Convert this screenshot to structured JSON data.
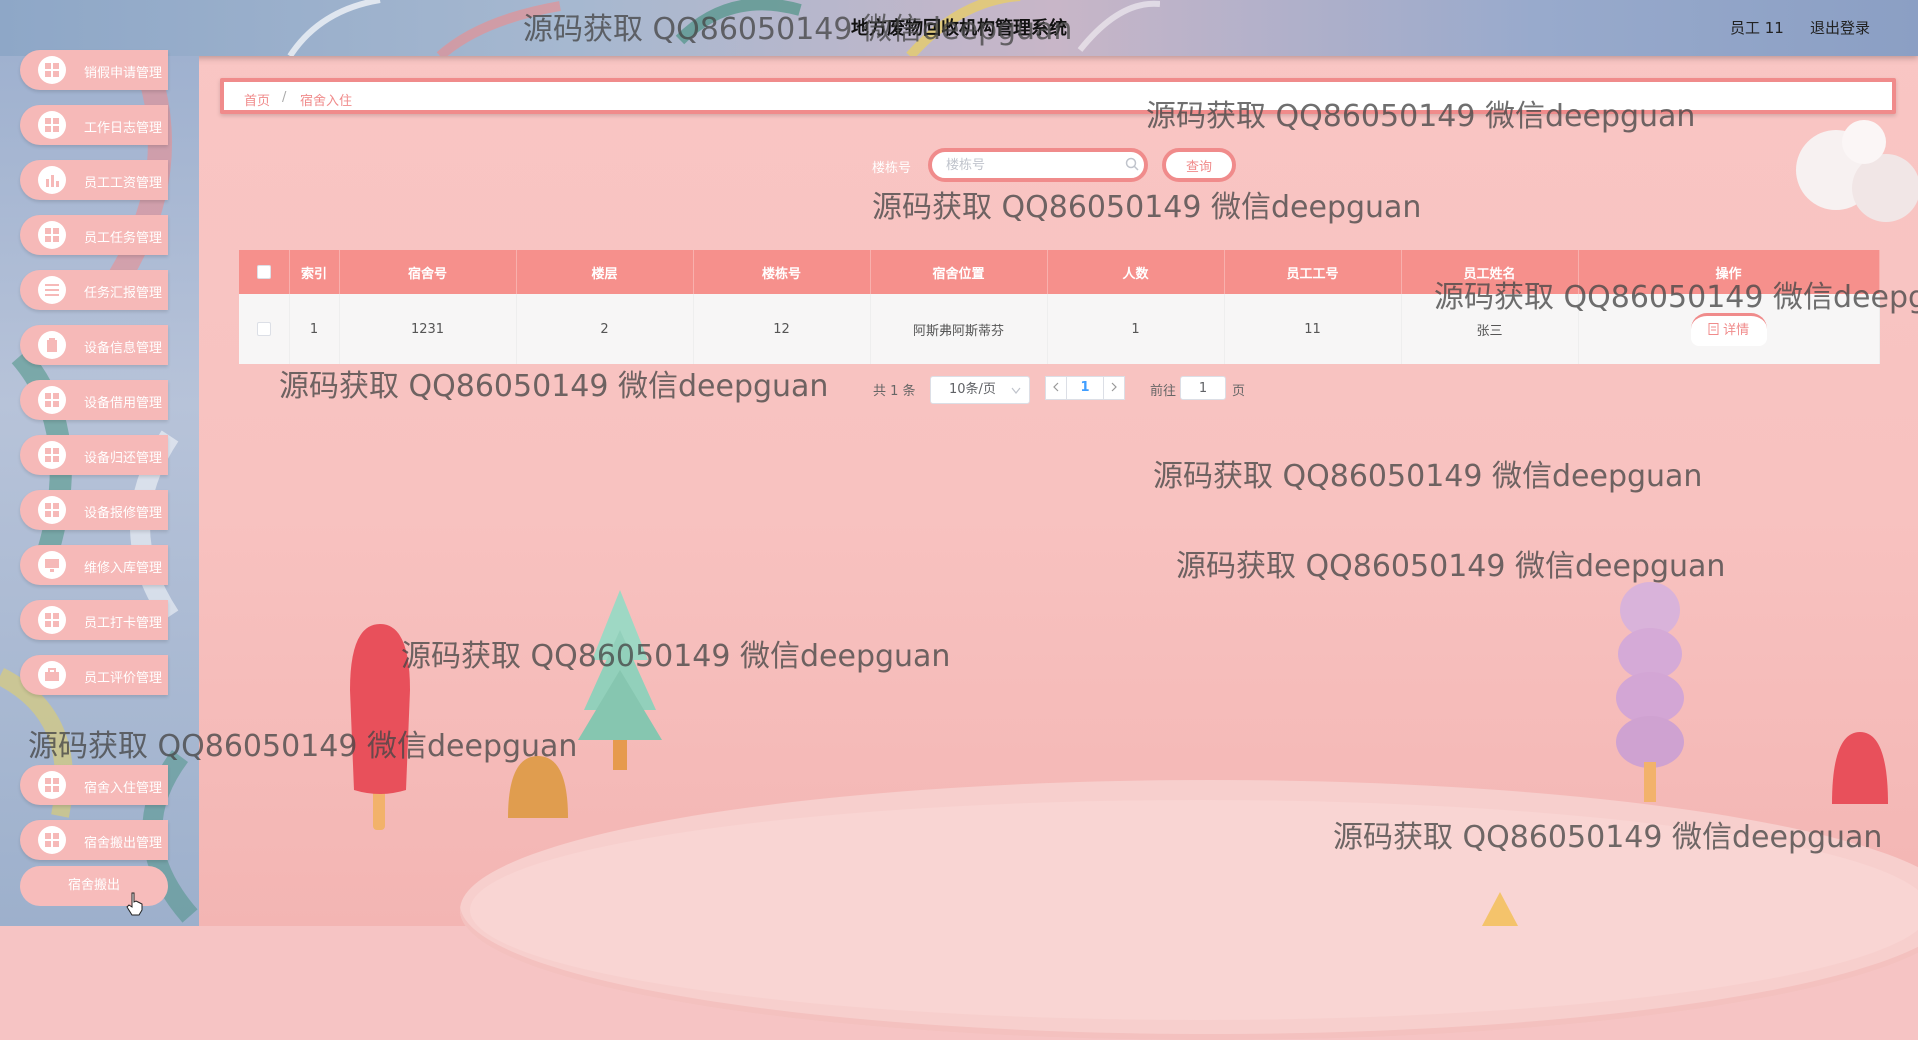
{
  "header": {
    "title": "地方废物回收机构管理系统",
    "user_label": "员工 11",
    "logout_label": "退出登录"
  },
  "sidebar": {
    "items": [
      {
        "label": "销假申请管理",
        "icon": "grid-icon"
      },
      {
        "label": "工作日志管理",
        "icon": "grid-icon"
      },
      {
        "label": "员工工资管理",
        "icon": "bar-chart-icon"
      },
      {
        "label": "员工任务管理",
        "icon": "grid-icon"
      },
      {
        "label": "任务汇报管理",
        "icon": "list-icon"
      },
      {
        "label": "设备信息管理",
        "icon": "clipboard-icon"
      },
      {
        "label": "设备借用管理",
        "icon": "grid-icon"
      },
      {
        "label": "设备归还管理",
        "icon": "grid-icon"
      },
      {
        "label": "设备报修管理",
        "icon": "grid-icon"
      },
      {
        "label": "维修入库管理",
        "icon": "monitor-icon"
      },
      {
        "label": "员工打卡管理",
        "icon": "grid-icon"
      },
      {
        "label": "员工评价管理",
        "icon": "briefcase-icon"
      },
      {
        "label": "宿舍入住管理",
        "icon": "grid-icon"
      },
      {
        "label": "宿舍搬出管理",
        "icon": "grid-icon"
      }
    ],
    "sub_item": "宿舍搬出"
  },
  "breadcrumb": {
    "home": "首页",
    "separator": "/",
    "current": "宿舍入住"
  },
  "search": {
    "label": "楼栋号",
    "placeholder": "楼栋号",
    "button": "查询"
  },
  "table": {
    "columns": [
      "索引",
      "宿舍号",
      "楼层",
      "楼栋号",
      "宿舍位置",
      "人数",
      "员工工号",
      "员工姓名",
      "操作"
    ],
    "rows": [
      {
        "index": "1",
        "dorm_no": "1231",
        "floor": "2",
        "building": "12",
        "location": "阿斯弗阿斯蒂芬",
        "count": "1",
        "emp_id": "11",
        "emp_name": "张三",
        "action": "详情"
      }
    ]
  },
  "pagination": {
    "total": "共 1 条",
    "page_size": "10条/页",
    "current_page": "1",
    "goto_prefix": "前往",
    "goto_value": "1",
    "goto_suffix": "页"
  },
  "watermark": "源码获取 QQ86050149 微信deepguan",
  "colors": {
    "accent": "#f08b8b",
    "header_bg": "#f6908c",
    "menu_bg": "#f6b9b8",
    "page_bg": "#f6c4c4"
  }
}
